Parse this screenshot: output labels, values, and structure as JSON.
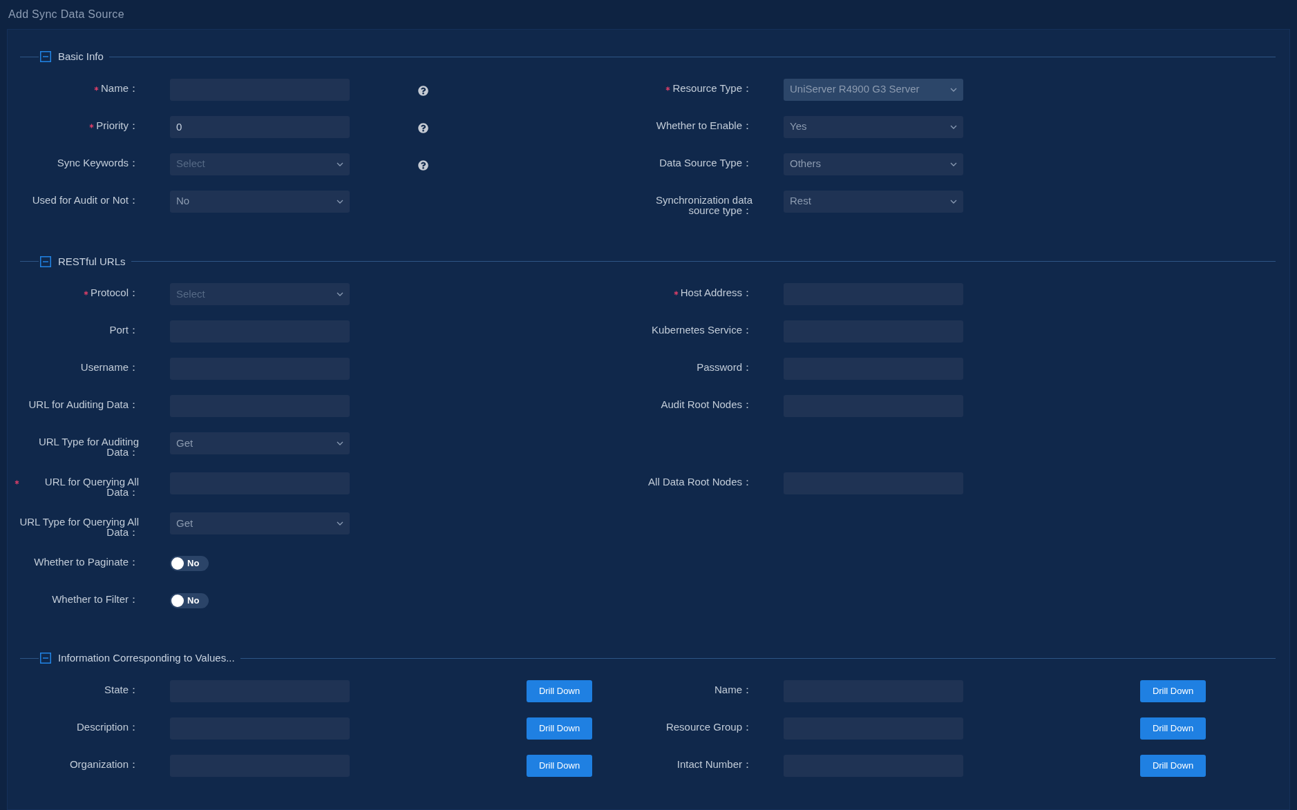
{
  "page_title": "Add Sync Data Source",
  "sections": [
    {
      "title": "Basic Info",
      "expanded": true,
      "rows": [
        {
          "left": {
            "kind": "input",
            "label": "Name：",
            "required": true,
            "help": true
          },
          "right": {
            "kind": "select",
            "label": "Resource Type：",
            "required": true,
            "value": "UniServer R4900 G3 Server",
            "disabled": true
          }
        },
        {
          "left": {
            "kind": "input",
            "label": "Priority：",
            "required": true,
            "value": "0",
            "help": true
          },
          "right": {
            "kind": "select",
            "label": "Whether to Enable：",
            "required": false,
            "value": "Yes",
            "disabled": false
          }
        },
        {
          "left": {
            "kind": "select",
            "label": "Sync Keywords：",
            "required": false,
            "placeholder": "Select",
            "disabled": false,
            "help": true
          },
          "right": {
            "kind": "select",
            "label": "Data Source Type：",
            "required": false,
            "value": "Others",
            "disabled": false
          }
        },
        {
          "left": {
            "kind": "select",
            "label": "Used for Audit or Not：",
            "required": false,
            "value": "No",
            "disabled": false
          },
          "right": {
            "kind": "select",
            "label": "Synchronization data source type：",
            "required": false,
            "value": "Rest",
            "disabled": false
          }
        }
      ]
    },
    {
      "title": "RESTful URLs",
      "expanded": true,
      "rows": [
        {
          "left": {
            "kind": "select",
            "label": "Protocol：",
            "required": true,
            "placeholder": "Select",
            "disabled": false
          },
          "right": {
            "kind": "input",
            "label": "Host Address：",
            "required": true
          }
        },
        {
          "left": {
            "kind": "input",
            "label": "Port：",
            "required": false
          },
          "right": {
            "kind": "input",
            "label": "Kubernetes Service：",
            "required": false
          }
        },
        {
          "left": {
            "kind": "input",
            "label": "Username：",
            "required": false
          },
          "right": {
            "kind": "input",
            "label": "Password：",
            "required": false
          }
        },
        {
          "left": {
            "kind": "input",
            "label": "URL for Auditing Data：",
            "required": false
          },
          "right": {
            "kind": "input",
            "label": "Audit Root Nodes：",
            "required": false
          }
        },
        {
          "left": {
            "kind": "select",
            "label": "URL Type for Auditing Data：",
            "required": false,
            "value": "Get",
            "disabled": false
          }
        },
        {
          "left": {
            "kind": "input",
            "label": "URL for Querying All Data：",
            "required": true
          },
          "right": {
            "kind": "input",
            "label": "All Data Root Nodes：",
            "required": false
          }
        },
        {
          "left": {
            "kind": "select",
            "label": "URL Type for Querying All Data：",
            "required": false,
            "value": "Get",
            "disabled": false
          }
        },
        {
          "left": {
            "kind": "toggle",
            "label": "Whether to Paginate：",
            "required": false,
            "on": false,
            "text": "No"
          }
        },
        {
          "left": {
            "kind": "toggle",
            "label": "Whether to Filter：",
            "required": false,
            "on": false,
            "text": "No"
          }
        }
      ]
    },
    {
      "title": "Information Corresponding to Values...",
      "expanded": true,
      "rows": [
        {
          "left": {
            "kind": "input",
            "label": "State：",
            "required": false,
            "action": "Drill Down"
          },
          "right": {
            "kind": "input",
            "label": "Name：",
            "required": false,
            "action": "Drill Down"
          }
        },
        {
          "left": {
            "kind": "input",
            "label": "Description：",
            "required": false,
            "action": "Drill Down"
          },
          "right": {
            "kind": "input",
            "label": "Resource Group：",
            "required": false,
            "action": "Drill Down"
          }
        },
        {
          "left": {
            "kind": "input",
            "label": "Organization：",
            "required": false,
            "action": "Drill Down"
          },
          "right": {
            "kind": "input",
            "label": "Intact Number：",
            "required": false,
            "action": "Drill Down"
          }
        }
      ]
    }
  ]
}
